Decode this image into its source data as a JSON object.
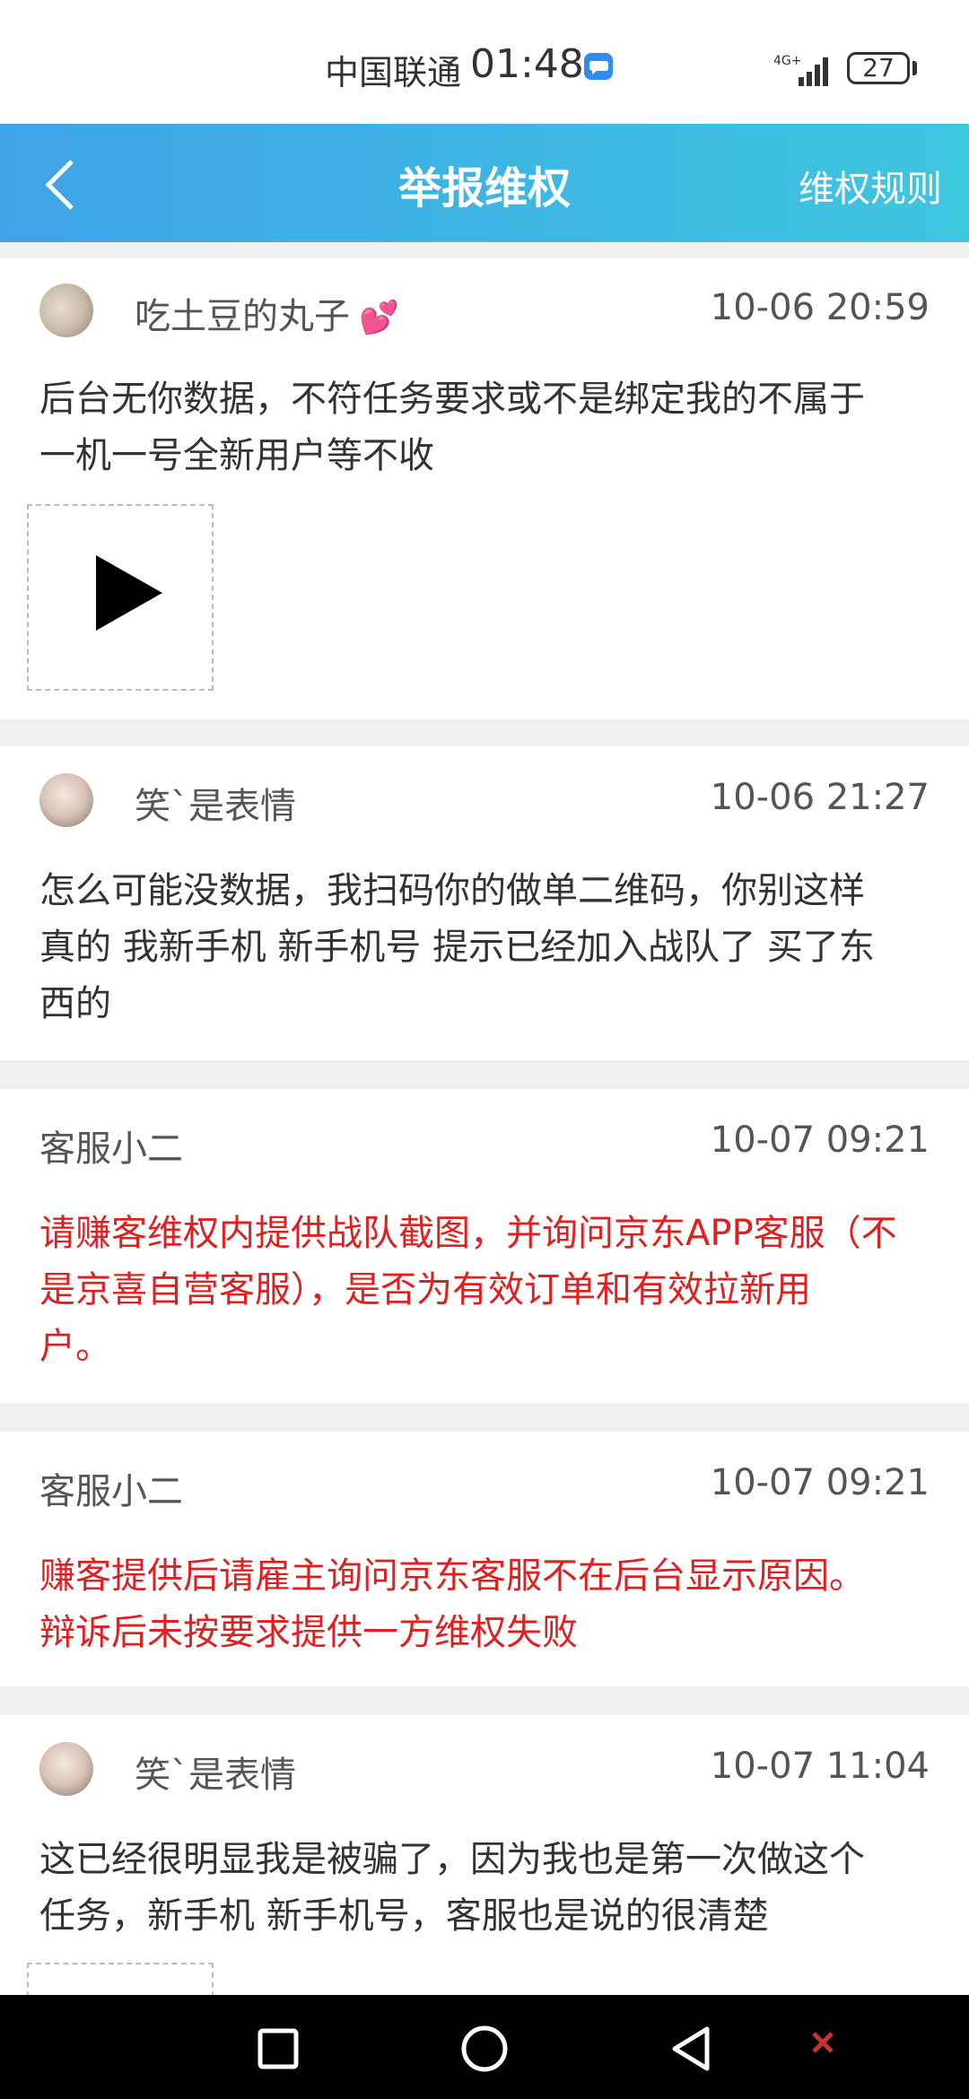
{
  "status_bar": {
    "carrier": "中国联通",
    "time": "01:48",
    "network": "4G+",
    "battery": "27"
  },
  "header": {
    "title": "举报维权",
    "rules_link": "维权规则"
  },
  "messages": [
    {
      "user": "吃土豆的丸子",
      "time": "10-06 20:59",
      "text": "后台无你数据，不符任务要求或不是绑定我的不属于\n一机一号全新用户等不收",
      "emoji": "💕",
      "has_video": true
    },
    {
      "user": "笑`是表情",
      "time": "10-06 21:27",
      "text": "怎么可能没数据，我扫码你的做单二维码，你别这样\n真的 我新手机 新手机号 提示已经加入战队了 买了东\n西的"
    },
    {
      "user": "客服小二",
      "time": "10-07 09:21",
      "text": "请赚客维权内提供战队截图，并询问京东APP客服（不\n是京喜自营客服），是否为有效订单和有效拉新用\n户。"
    },
    {
      "user": "客服小二",
      "time": "10-07 09:21",
      "text": "赚客提供后请雇主询问京东客服不在后台显示原因。\n辩诉后未按要求提供一方维权失败"
    },
    {
      "user": "笑`是表情",
      "time": "10-07 11:04",
      "text": "这已经很明显我是被骗了，因为我也是第一次做这个\n任务，新手机 新手机号，客服也是说的很清楚"
    }
  ],
  "icons": {
    "back": "chevron-left-icon",
    "play": "play-icon",
    "recents": "square-icon",
    "home": "circle-icon",
    "nav_back": "triangle-back-icon"
  },
  "colors": {
    "header_start": "#3fa3e8",
    "header_end": "#3ec6df",
    "staff_text": "#e02020"
  }
}
